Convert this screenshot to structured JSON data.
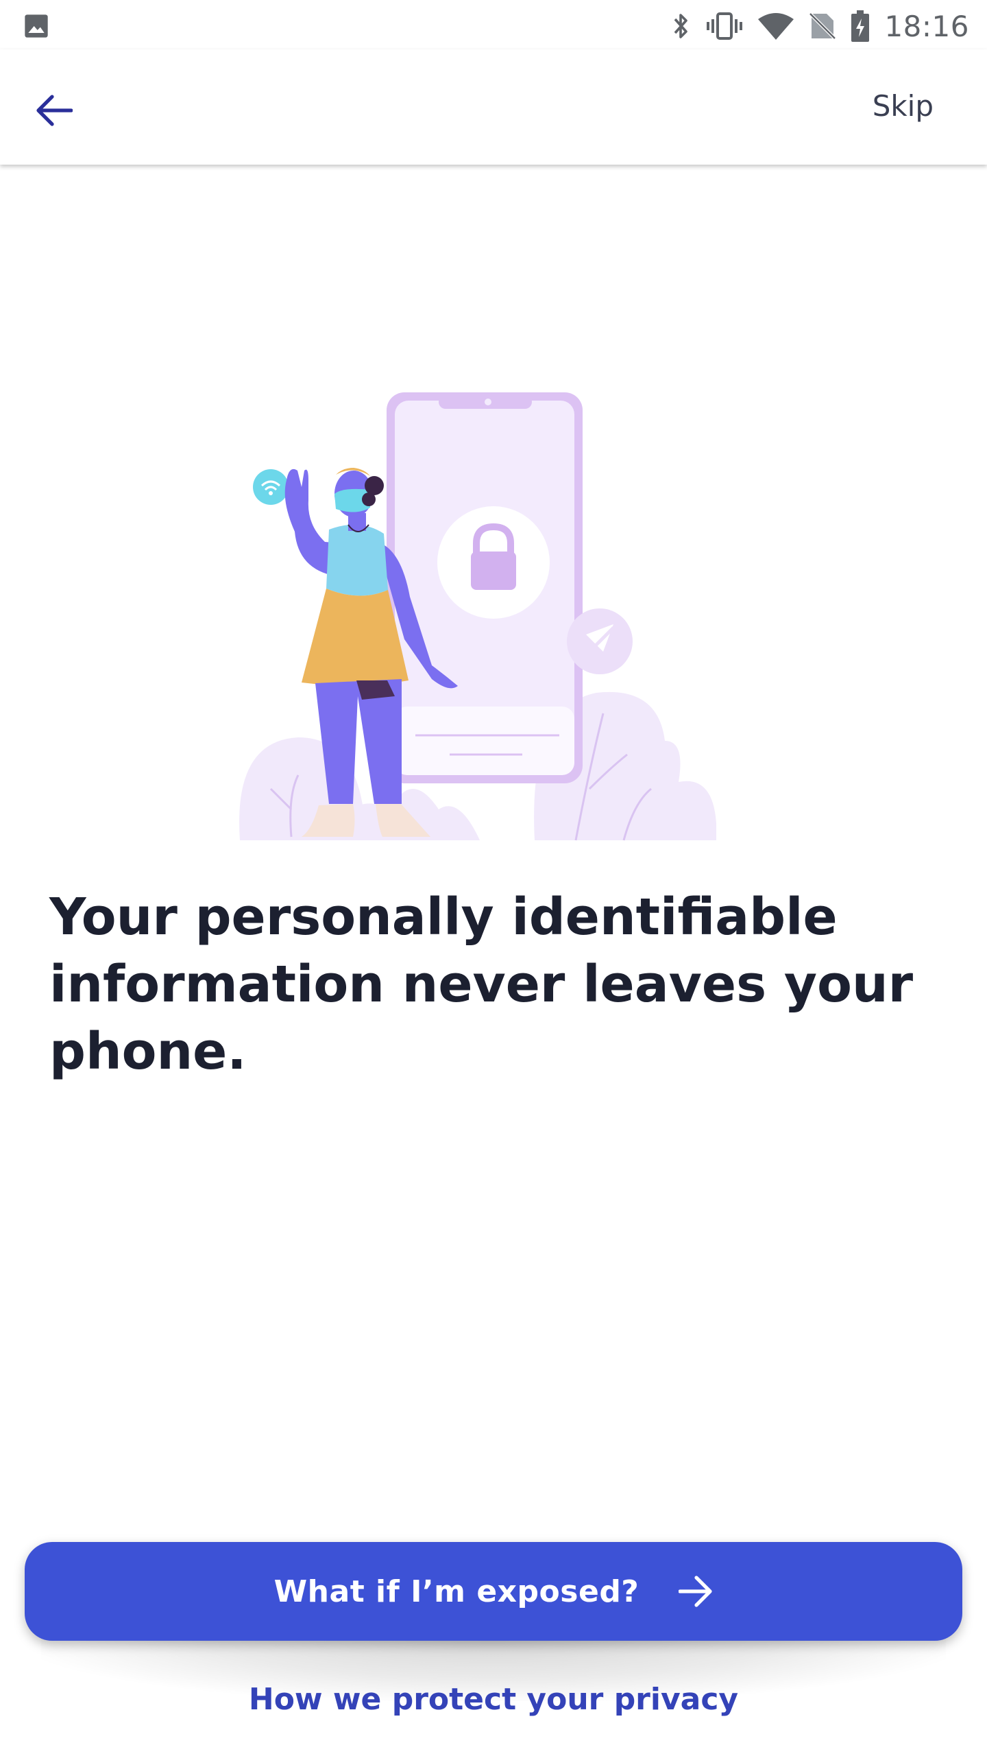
{
  "status_bar": {
    "time": "18:16",
    "icons": [
      "gallery-icon",
      "bluetooth-icon",
      "vibrate-icon",
      "wifi-icon",
      "no-sim-icon",
      "battery-charging-icon"
    ]
  },
  "app_bar": {
    "back_icon": "arrow-left-icon",
    "skip_label": "Skip"
  },
  "illustration": {
    "description_icon": "woman-with-phone-lock-illustration"
  },
  "content": {
    "headline": "Your personally identifiable information never leaves your phone."
  },
  "actions": {
    "primary_label": "What if I’m exposed?",
    "primary_icon": "arrow-right-icon",
    "secondary_label": "How we protect your privacy"
  },
  "colors": {
    "primary": "#3d52d6",
    "link": "#3443b8",
    "headline": "#1c2030",
    "illustration_lavender": "#e7d8f6"
  }
}
